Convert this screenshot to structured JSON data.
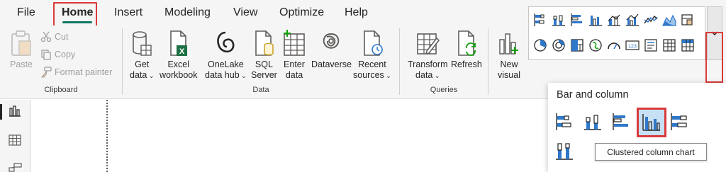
{
  "menu": {
    "items": [
      {
        "label": "File"
      },
      {
        "label": "Home",
        "active": true
      },
      {
        "label": "Insert"
      },
      {
        "label": "Modeling"
      },
      {
        "label": "View"
      },
      {
        "label": "Optimize"
      },
      {
        "label": "Help"
      }
    ]
  },
  "ribbon": {
    "clipboard": {
      "paste_label": "Paste",
      "cut_label": "Cut",
      "copy_label": "Copy",
      "format_painter_label": "Format painter",
      "group_label": "Clipboard"
    },
    "data": {
      "get_data": [
        "Get",
        "data"
      ],
      "excel": [
        "Excel",
        "workbook"
      ],
      "onelake": [
        "OneLake",
        "data hub"
      ],
      "sql": [
        "SQL",
        "Server"
      ],
      "enter_data": [
        "Enter",
        "data"
      ],
      "dataverse": [
        "Dataverse"
      ],
      "recent_sources": [
        "Recent",
        "sources"
      ],
      "group_label": "Data"
    },
    "queries": {
      "transform": [
        "Transform",
        "data"
      ],
      "refresh": [
        "Refresh"
      ],
      "group_label": "Queries"
    },
    "insert": {
      "new_visual": [
        "New",
        "visual"
      ]
    }
  },
  "dropdown": {
    "title": "Bar and column",
    "tooltip": "Clustered column chart"
  },
  "colors": {
    "accent": "#117865",
    "highlight_border": "#d93a3a",
    "chart_blue": "#2f77c9",
    "icon_gray": "#605e5c"
  }
}
